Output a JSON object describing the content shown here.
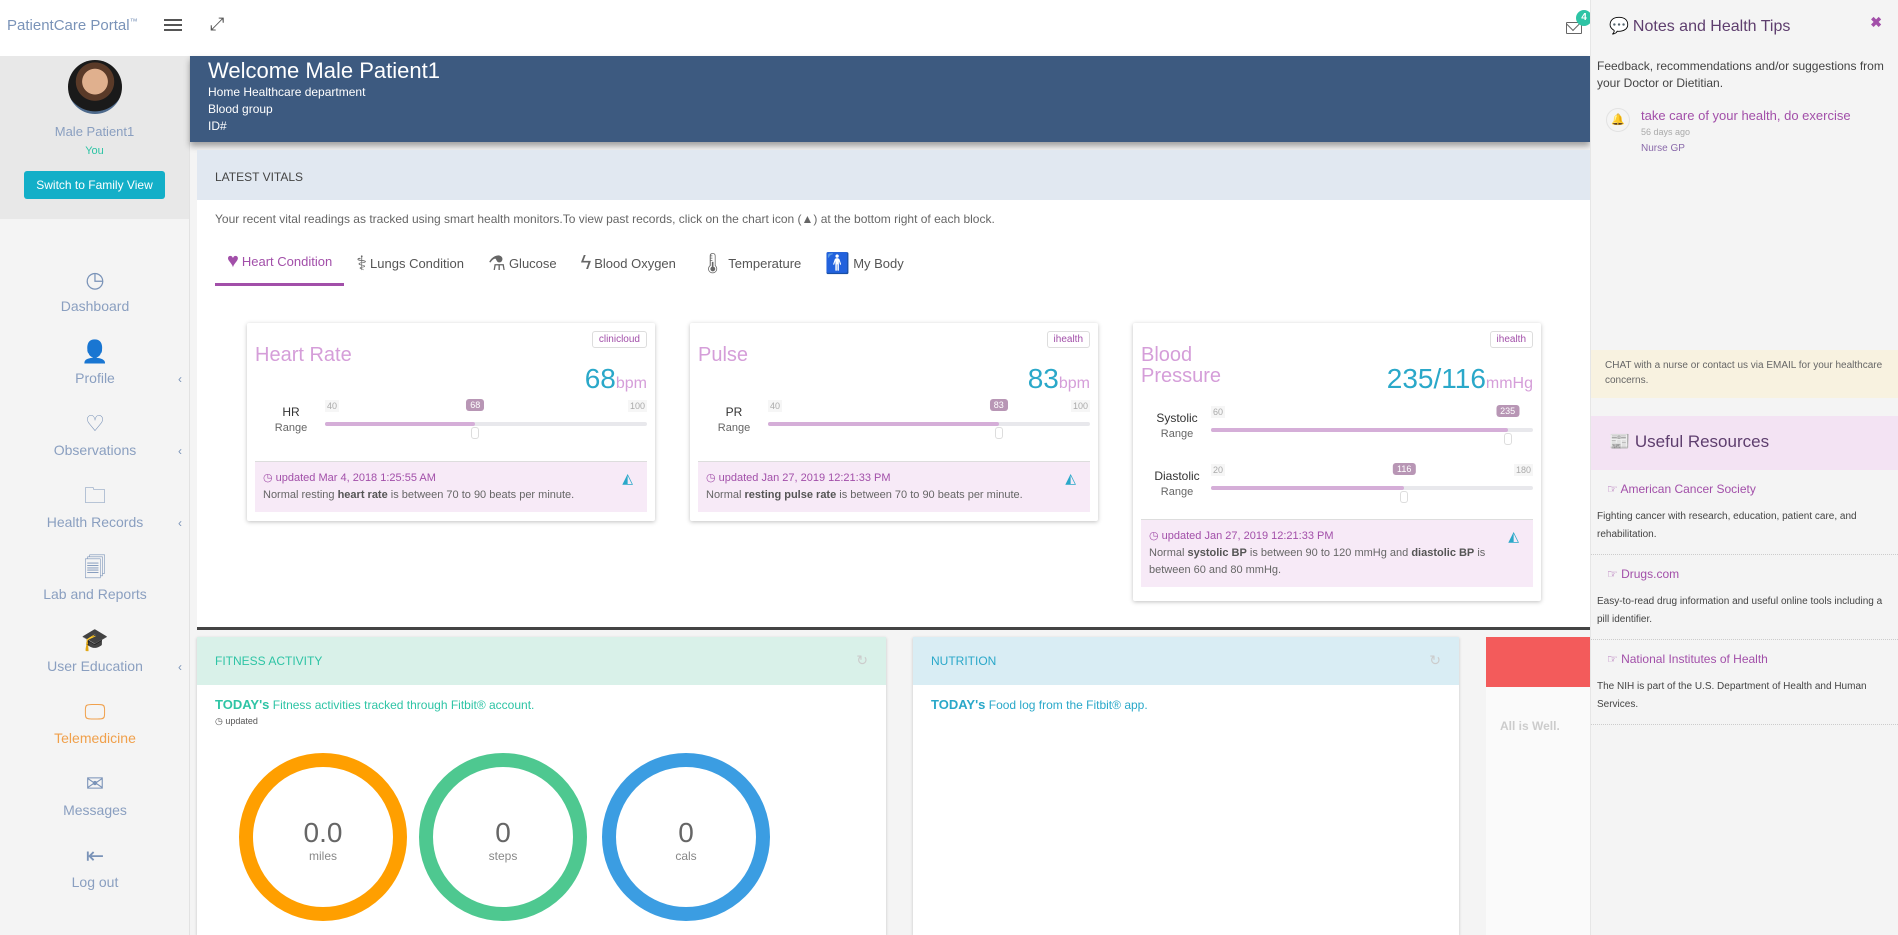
{
  "topbar": {
    "brand": "PatientCare Portal",
    "brand_tm": "™",
    "mail_badge": "4"
  },
  "user": {
    "name": "Male Patient1",
    "relation": "You",
    "family_button": "Switch to Family View"
  },
  "nav": [
    {
      "label": "Dashboard",
      "icon": "dashboard-icon",
      "glyph": "◷",
      "chevron": false,
      "active": false
    },
    {
      "label": "Profile",
      "icon": "user-icon",
      "glyph": "👤",
      "chevron": true,
      "active": false
    },
    {
      "label": "Observations",
      "icon": "heart-icon",
      "glyph": "♡",
      "chevron": true,
      "active": false
    },
    {
      "label": "Health Records",
      "icon": "folder-icon",
      "glyph": "🗀",
      "chevron": true,
      "active": false
    },
    {
      "label": "Lab and Reports",
      "icon": "files-icon",
      "glyph": "🗐",
      "chevron": false,
      "active": false
    },
    {
      "label": "User Education",
      "icon": "graduation-cap-icon",
      "glyph": "🎓",
      "chevron": true,
      "active": false
    },
    {
      "label": "Telemedicine",
      "icon": "monitor-icon",
      "glyph": "🖵",
      "chevron": false,
      "active": true
    },
    {
      "label": "Messages",
      "icon": "envelope-icon",
      "glyph": "✉",
      "chevron": false,
      "active": false
    },
    {
      "label": "Log out",
      "icon": "logout-icon",
      "glyph": "⇤",
      "chevron": false,
      "active": false
    }
  ],
  "banner": {
    "title": "Welcome Male Patient1",
    "department": "Home Healthcare department",
    "blood_group": "Blood group",
    "id": "ID#"
  },
  "vitals": {
    "header": "LATEST VITALS",
    "description": "Your recent vital readings as tracked using smart health monitors.To view past records, click on the chart icon (▲) at the bottom right of each block.",
    "tabs": [
      {
        "label": "Heart Condition",
        "glyph": "♥",
        "active": true
      },
      {
        "label": "Lungs Condition",
        "glyph": "⚕",
        "active": false
      },
      {
        "label": "Glucose",
        "glyph": "⚗",
        "active": false
      },
      {
        "label": "Blood Oxygen",
        "glyph": "ϟ",
        "active": false
      },
      {
        "label": "Temperature",
        "glyph": "🌡",
        "active": false
      },
      {
        "label": "My Body",
        "glyph": "🚹",
        "active": false
      }
    ],
    "cards": [
      {
        "title": "Heart Rate",
        "source": "clinicloud",
        "value": "68",
        "unit": "bpm",
        "ranges": [
          {
            "label": "HR",
            "sub": "Range",
            "min": 40,
            "max": 100,
            "value": 68,
            "show_max": true
          }
        ],
        "updated": "updated Mar 4, 2018 1:25:55 AM",
        "note_pre": "Normal resting ",
        "note_bold": "heart rate",
        "note_post": " is between 70 to 90 beats per minute."
      },
      {
        "title": "Pulse",
        "source": "ihealth",
        "value": "83",
        "unit": "bpm",
        "ranges": [
          {
            "label": "PR",
            "sub": "Range",
            "min": 40,
            "max": 100,
            "value": 83,
            "show_max": true
          }
        ],
        "updated": "updated Jan 27, 2019 12:21:33 PM",
        "note_pre": "Normal ",
        "note_bold": "resting pulse rate",
        "note_post": " is between 70 to 90 beats per minute."
      },
      {
        "title": "Blood Pressure",
        "source": "ihealth",
        "value": "235/116",
        "unit": "mmHg",
        "ranges": [
          {
            "label": "Systolic",
            "sub": "Range",
            "min": 60,
            "max": 250,
            "value": 235,
            "show_max": false
          },
          {
            "label": "Diastolic",
            "sub": "Range",
            "min": 20,
            "max": 180,
            "value": 116,
            "show_max": true
          }
        ],
        "updated": "updated Jan 27, 2019 12:21:33 PM",
        "note_pre": "Normal ",
        "note_bold": "systolic BP",
        "note_post": " is between 90 to 120 mmHg and ",
        "note_bold2": "diastolic BP",
        "note_post2": " is between 60 and 80 mmHg."
      }
    ]
  },
  "fitness": {
    "header": "FITNESS ACTIVITY",
    "today": "TODAY's",
    "text": "Fitness activities tracked through Fitbit® account.",
    "updated": "updated",
    "rings": [
      {
        "value": "0.0",
        "unit": "miles",
        "color": "#ff9f00"
      },
      {
        "value": "0",
        "unit": "steps",
        "color": "#4ec890"
      },
      {
        "value": "0",
        "unit": "cals",
        "color": "#3b9de2"
      }
    ]
  },
  "nutrition": {
    "header": "NUTRITION",
    "today": "TODAY's",
    "text": "Food log from the Fitbit® app."
  },
  "alert": {
    "text": "All is Well.",
    "color": "#f35b5b"
  },
  "notes_panel": {
    "title": "Notes and Health Tips",
    "description": "Feedback, recommendations and/or suggestions from your Doctor or Dietitian.",
    "notes": [
      {
        "text": "take care of your health, do exercise",
        "ago": "56 days ago",
        "author": "Nurse GP"
      }
    ],
    "chat_text": "CHAT with a nurse or contact us via EMAIL for your healthcare concerns.",
    "resources_title": "Useful Resources",
    "resources": [
      {
        "name": "American Cancer Society",
        "desc": "Fighting cancer with research, education, patient care, and rehabilitation."
      },
      {
        "name": "Drugs.com",
        "desc": "Easy-to-read drug information and useful online tools including a pill identifier."
      },
      {
        "name": "National Institutes of Health",
        "desc": "The NIH is part of the U.S. Department of Health and Human Services."
      }
    ]
  }
}
